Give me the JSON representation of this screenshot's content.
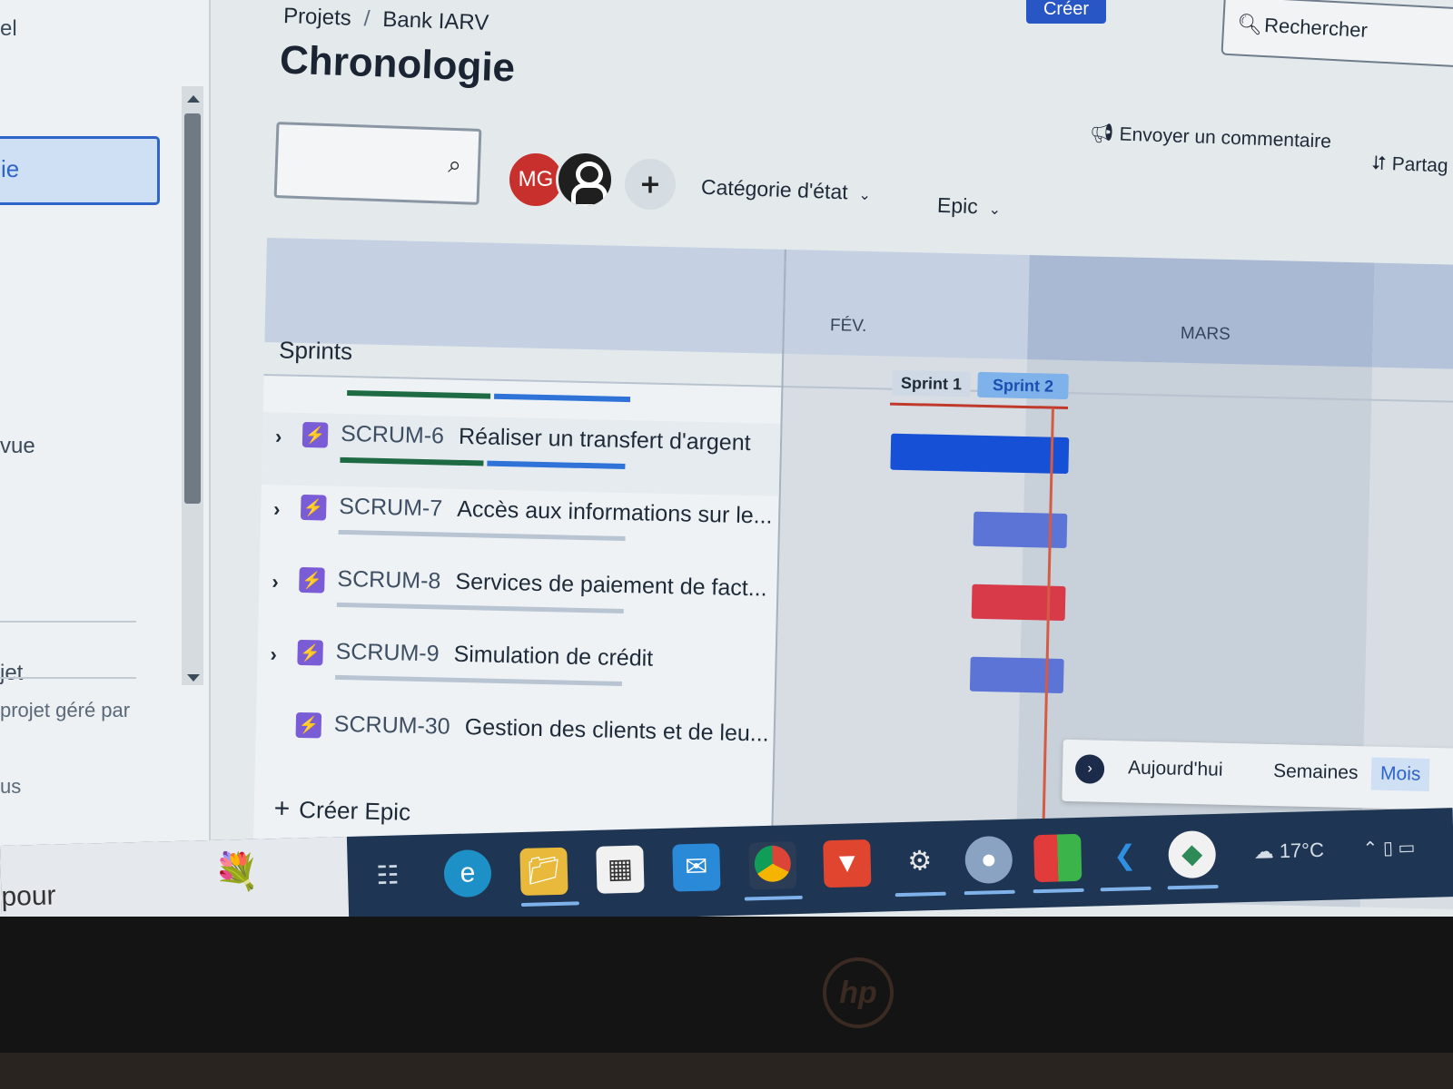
{
  "breadcrumb": {
    "projects": "Projets",
    "separator": "/",
    "project": "Bank IARV"
  },
  "page_title": "Chronologie",
  "header": {
    "create_label": "Créer",
    "search_label": "Rechercher"
  },
  "sidebar": {
    "top_text": "el",
    "active_item": "ie",
    "item_vue": "vue",
    "item_jet": "jet",
    "managed_text": "projet géré par",
    "item_us": "us"
  },
  "toolbar": {
    "avatar_initials": "MG",
    "status_category": "Catégorie d'état",
    "epic_filter": "Epic",
    "feedback": "Envoyer un commentaire",
    "share": "Partag"
  },
  "timeline": {
    "column_header": "Sprints",
    "months": [
      "FÉV.",
      "MARS"
    ],
    "sprints": [
      "Sprint 1",
      "Sprint 2"
    ],
    "epics": [
      {
        "key": "SCRUM-6",
        "title": "Réaliser un transfert d'argent",
        "color": "#1550d6",
        "progress_done": 0.5,
        "progress_inprogress": 0.48
      },
      {
        "key": "SCRUM-7",
        "title": "Accès aux informations sur le...",
        "color": "#5b74d6",
        "progress_done": 0,
        "progress_inprogress": 0
      },
      {
        "key": "SCRUM-8",
        "title": "Services de paiement de fact...",
        "color": "#d83a4a",
        "progress_done": 0,
        "progress_inprogress": 0
      },
      {
        "key": "SCRUM-9",
        "title": "Simulation de crédit",
        "color": "#5b74d6",
        "progress_done": 0,
        "progress_inprogress": 0
      },
      {
        "key": "SCRUM-30",
        "title": "Gestion des clients et de leu...",
        "color": "",
        "progress_done": 0,
        "progress_inprogress": 0
      }
    ],
    "create_epic": "Créer Epic"
  },
  "zoom": {
    "today": "Aujourd'hui",
    "weeks": "Semaines",
    "months": "Mois",
    "selected": "Mois"
  },
  "taskbar": {
    "left_text": "pour",
    "weather": "17°C"
  },
  "colors": {
    "accent": "#2f65c9",
    "today_line": "#d55b45",
    "done": "#1e6b43",
    "in_progress": "#2f73d8"
  }
}
